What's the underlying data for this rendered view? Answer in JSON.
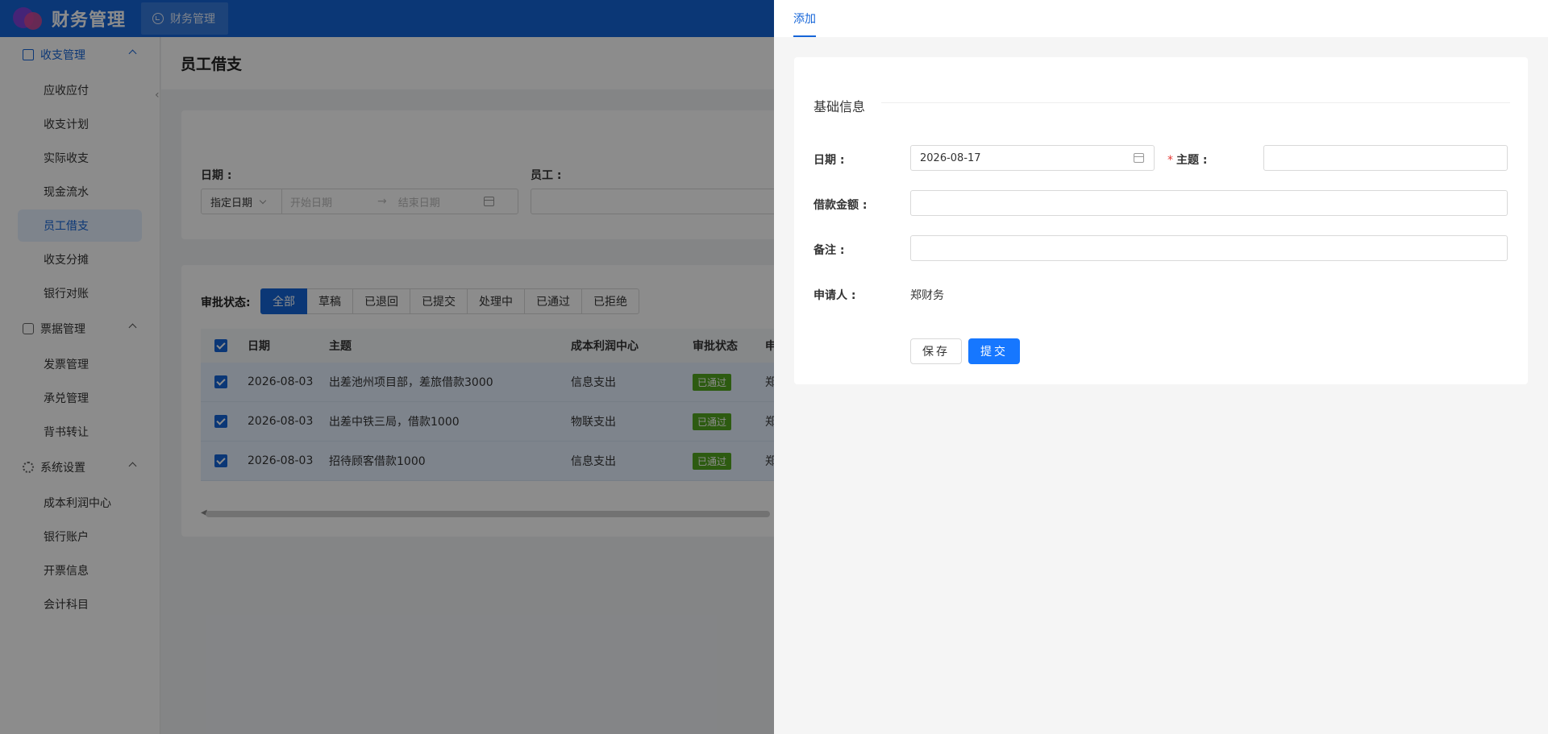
{
  "header": {
    "app_title": "财务管理",
    "tab_label": "财务管理"
  },
  "sidebar": {
    "groups": [
      {
        "label": "收支管理",
        "icon": "list-icon",
        "active": true,
        "items": [
          "应收应付",
          "收支计划",
          "实际收支",
          "现金流水",
          "员工借支",
          "收支分摊",
          "银行对账"
        ]
      },
      {
        "label": "票据管理",
        "icon": "ticket-icon",
        "items": [
          "发票管理",
          "承兑管理",
          "背书转让"
        ]
      },
      {
        "label": "系统设置",
        "icon": "gear-icon",
        "items": [
          "成本利润中心",
          "银行账户",
          "开票信息",
          "会计科目"
        ]
      }
    ],
    "active_item": "员工借支"
  },
  "page": {
    "title": "员工借支",
    "filter": {
      "date_label": "日期 :",
      "date_mode": "指定日期",
      "start_placeholder": "开始日期",
      "end_placeholder": "结束日期",
      "employee_label": "员工 :"
    },
    "status_label": "审批状态:",
    "status_options": [
      "全部",
      "草稿",
      "已退回",
      "已提交",
      "处理中",
      "已通过",
      "已拒绝"
    ],
    "status_selected": "全部",
    "table": {
      "columns": [
        "日期",
        "主题",
        "成本利润中心",
        "审批状态",
        "申"
      ],
      "rows": [
        {
          "date": "2026-08-03",
          "subject": "出差池州项目部，差旅借款3000",
          "center": "信息支出",
          "status": "已通过",
          "applicant": "郑"
        },
        {
          "date": "2026-08-03",
          "subject": "出差中铁三局，借款1000",
          "center": "物联支出",
          "status": "已通过",
          "applicant": "郑"
        },
        {
          "date": "2026-08-03",
          "subject": "招待顾客借款1000",
          "center": "信息支出",
          "status": "已通过",
          "applicant": "郑"
        }
      ]
    }
  },
  "drawer": {
    "tab": "添加",
    "section_title": "基础信息",
    "date_label": "日期 :",
    "date_value": "2026-08-17",
    "subject_required_mark": "*",
    "subject_label": "主题 :",
    "subject_value": "",
    "amount_label": "借款金额 :",
    "amount_value": "",
    "note_label": "备注 :",
    "note_value": "",
    "applicant_label": "申请人 :",
    "applicant_value": "郑财务",
    "save_button": "保存",
    "submit_button": "提交"
  },
  "colors": {
    "primary": "#1565d8",
    "success_tag": "#52a620",
    "required": "#e53935"
  }
}
